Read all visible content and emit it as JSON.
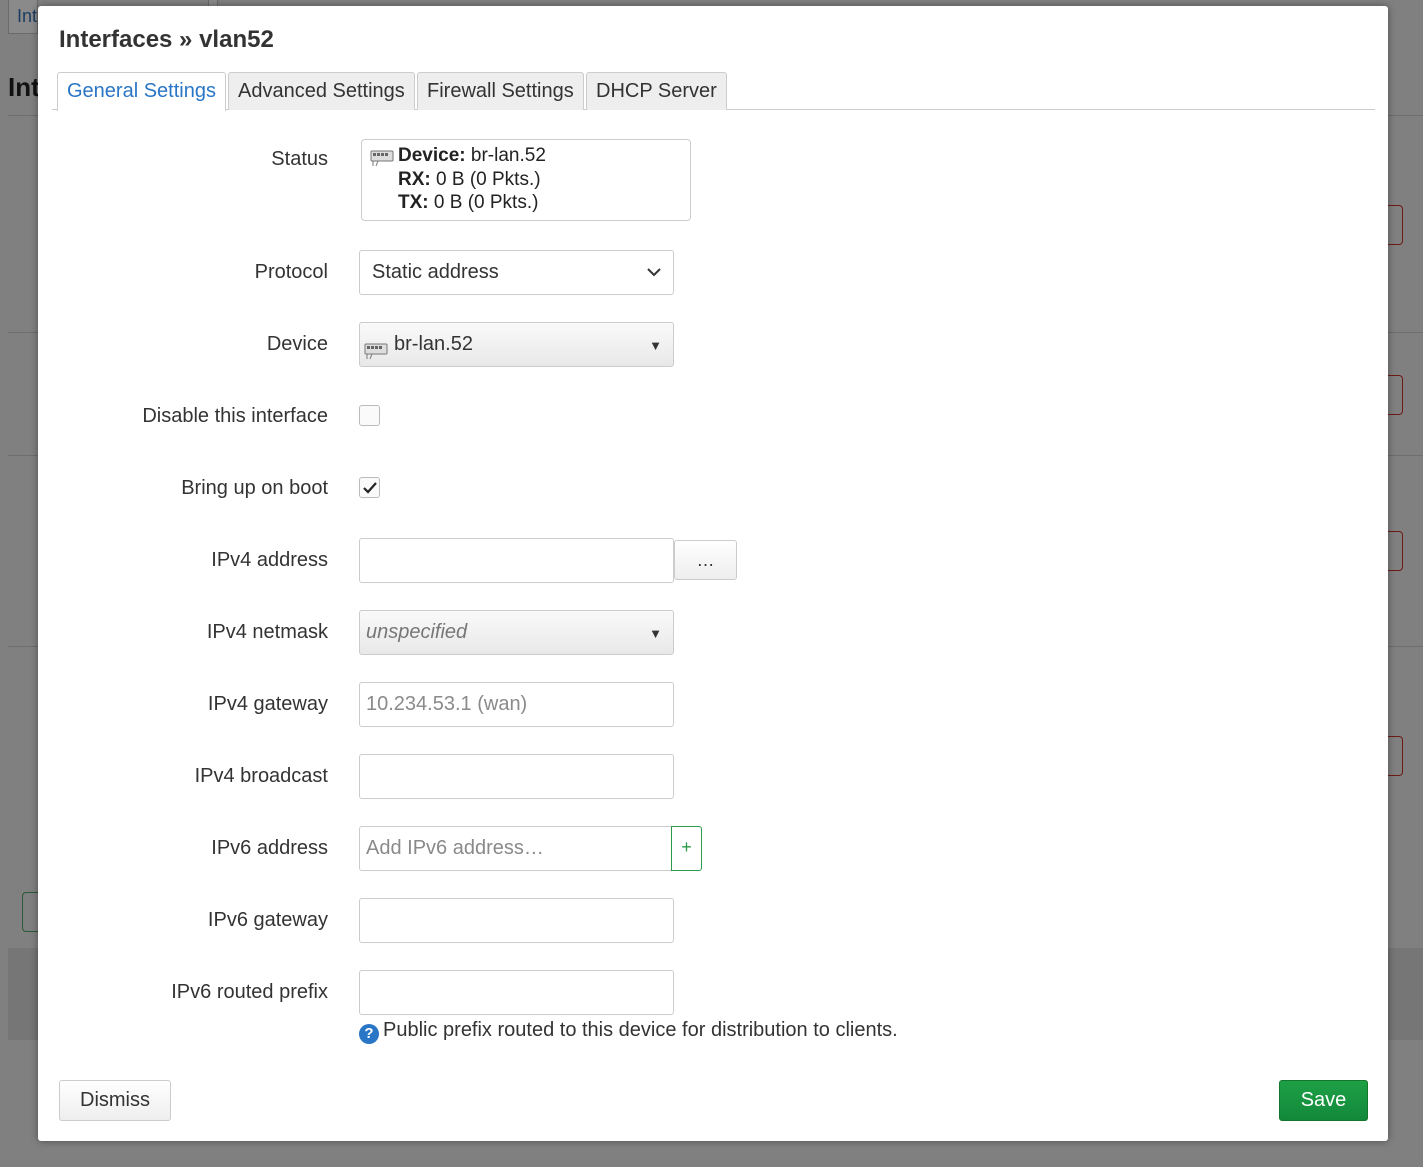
{
  "background": {
    "tab_text": "Int",
    "heading": "Int"
  },
  "modal": {
    "title": "Interfaces » vlan52",
    "tabs": [
      {
        "label": "General Settings",
        "active": true
      },
      {
        "label": "Advanced Settings",
        "active": false
      },
      {
        "label": "Firewall Settings",
        "active": false
      },
      {
        "label": "DHCP Server",
        "active": false
      }
    ],
    "status": {
      "label": "Status",
      "device_key": "Device:",
      "device_value": "br-lan.52",
      "rx_key": "RX:",
      "rx_value": "0 B (0 Pkts.)",
      "tx_key": "TX:",
      "tx_value": "0 B (0 Pkts.)"
    },
    "protocol": {
      "label": "Protocol",
      "value": "Static address"
    },
    "device": {
      "label": "Device",
      "value": "br-lan.52"
    },
    "disable_interface": {
      "label": "Disable this interface",
      "checked": false
    },
    "bring_up_on_boot": {
      "label": "Bring up on boot",
      "checked": true
    },
    "ipv4_address": {
      "label": "IPv4 address",
      "value": "",
      "extra_button": "…"
    },
    "ipv4_netmask": {
      "label": "IPv4 netmask",
      "value": "unspecified"
    },
    "ipv4_gateway": {
      "label": "IPv4 gateway",
      "placeholder": "10.234.53.1 (wan)"
    },
    "ipv4_broadcast": {
      "label": "IPv4 broadcast",
      "value": ""
    },
    "ipv6_address": {
      "label": "IPv6 address",
      "placeholder": "Add IPv6 address…",
      "add_button": "+"
    },
    "ipv6_gateway": {
      "label": "IPv6 gateway",
      "value": ""
    },
    "ipv6_routed_prefix": {
      "label": "IPv6 routed prefix",
      "value": "",
      "help": "Public prefix routed to this device for distribution to clients."
    },
    "buttons": {
      "dismiss": "Dismiss",
      "save": "Save"
    }
  },
  "colors": {
    "accent": "#2a76c6",
    "save": "#1a9640",
    "overlay": "#808080"
  }
}
